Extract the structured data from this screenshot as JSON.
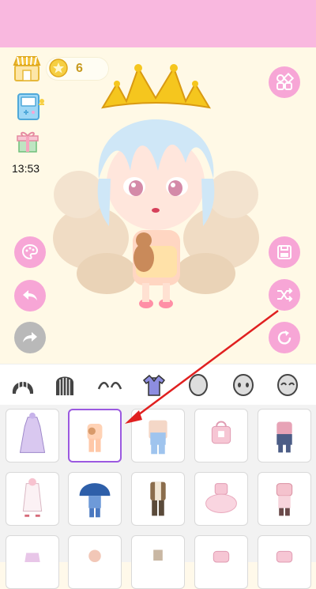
{
  "status": {
    "time": "13:53"
  },
  "currency": {
    "coins": "6"
  },
  "icons": {
    "shop": "shop-icon",
    "coin": "star-coin-icon",
    "arcade": "arcade-machine-icon",
    "gift": "gift-icon",
    "menu": "grid-menu-icon",
    "palette": "palette-icon",
    "undo": "undo-icon",
    "redo": "redo-icon",
    "save": "save-icon",
    "random": "shuffle-icon",
    "reset": "reset-icon"
  },
  "colors": {
    "top_bar": "#f9b8df",
    "stage_bg": "#fff9e6",
    "accent_pink": "#f7a6d6",
    "selected_border": "#9b59e0",
    "annotation_arrow": "#e02020"
  },
  "categories": [
    "hair-front-icon",
    "hair-back-icon",
    "eyebrows-icon",
    "outfit-icon",
    "face-shape-icon",
    "face-expression-icon",
    "face-closed-eyes-icon"
  ],
  "outfits": {
    "selected_index": 1,
    "items": [
      "lavender-dress-outfit",
      "peach-bear-outfit",
      "blue-overalls-outfit",
      "pink-ribbon-outfit",
      "navy-maid-outfit",
      "white-angel-outfit",
      "blue-mushroom-outfit",
      "brown-vest-outfit",
      "pink-tutu-outfit",
      "pink-wedding-outfit",
      "partial-outfit-1",
      "partial-outfit-2",
      "partial-outfit-3",
      "partial-outfit-4",
      "partial-outfit-5"
    ]
  }
}
